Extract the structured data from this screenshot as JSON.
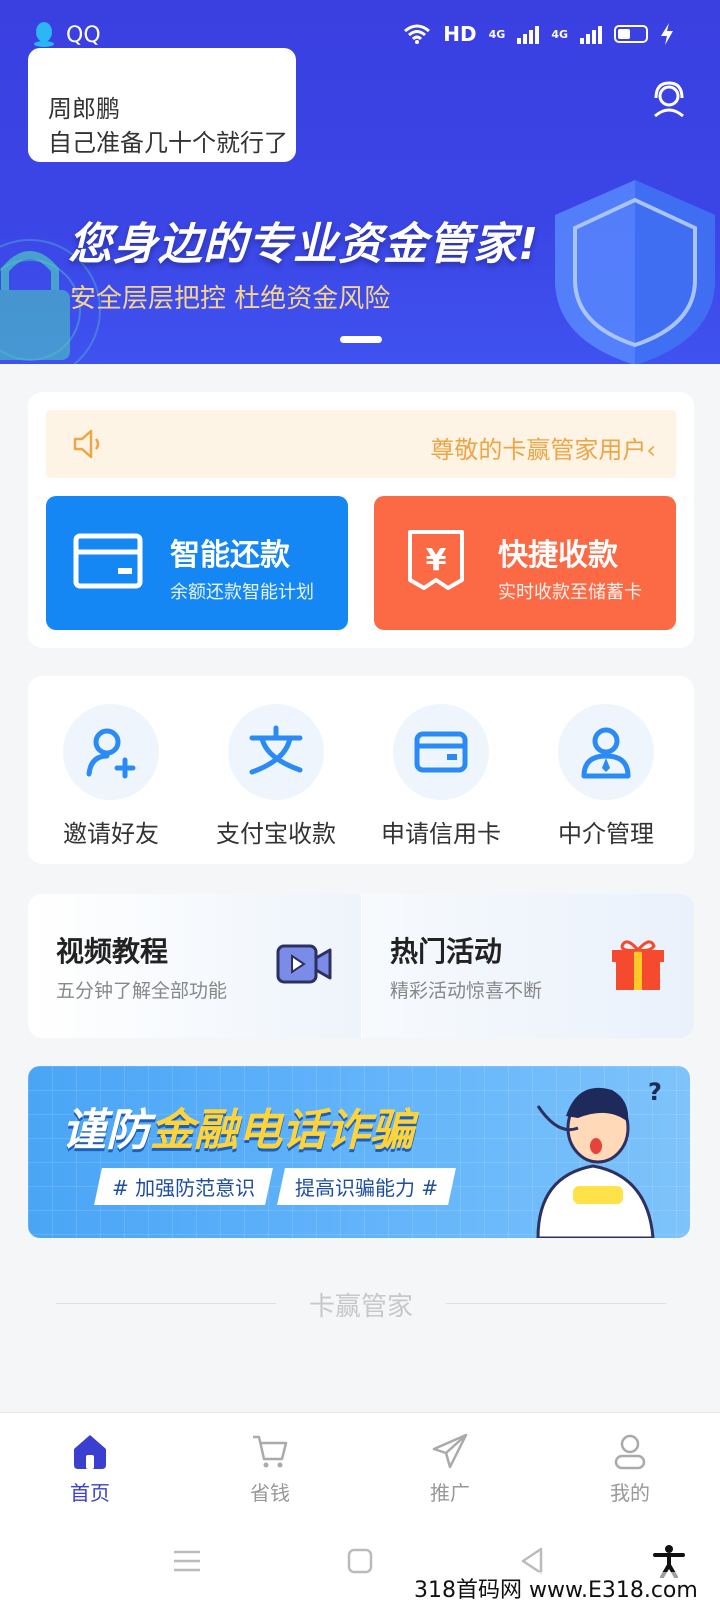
{
  "status_bar": {
    "app_name": "QQ",
    "network": "HD",
    "signal1": "4G",
    "signal2": "4G"
  },
  "notification": {
    "sender": "周郎鹏",
    "message": "自己准备几十个就行了"
  },
  "banner": {
    "title": "您身边的专业资金管家!",
    "subtitle": "安全层层把控 杜绝资金风险"
  },
  "notice": {
    "text": "尊敬的卡赢管家用户‹"
  },
  "actions": [
    {
      "title": "智能还款",
      "subtitle": "余额还款智能计划",
      "icon": "card-icon",
      "color": "#1487f5"
    },
    {
      "title": "快捷收款",
      "subtitle": "实时收款至储蓄卡",
      "icon": "yen-receipt-icon",
      "color": "#fb6a44"
    }
  ],
  "grid": [
    {
      "label": "邀请好友",
      "icon": "add-user-icon"
    },
    {
      "label": "支付宝收款",
      "icon": "alipay-icon"
    },
    {
      "label": "申请信用卡",
      "icon": "credit-card-icon"
    },
    {
      "label": "中介管理",
      "icon": "agent-icon"
    }
  ],
  "promos": [
    {
      "title": "视频教程",
      "subtitle": "五分钟了解全部功能",
      "icon": "video-icon"
    },
    {
      "title": "热门活动",
      "subtitle": "精彩活动惊喜不断",
      "icon": "gift-icon"
    }
  ],
  "fraud_banner": {
    "title_a": "谨防",
    "title_b": "金融电话诈骗",
    "tag1": "# 加强防范意识",
    "tag2": "提高识骗能力 #"
  },
  "footer": {
    "brand": "卡赢管家"
  },
  "tabs": [
    {
      "label": "首页",
      "icon": "home-icon",
      "active": true
    },
    {
      "label": "省钱",
      "icon": "cart-icon",
      "active": false
    },
    {
      "label": "推广",
      "icon": "send-icon",
      "active": false
    },
    {
      "label": "我的",
      "icon": "profile-icon",
      "active": false
    }
  ],
  "colors": {
    "header_blue": "#3a3fe0",
    "accent_blue": "#1487f5",
    "accent_orange": "#fb6a44",
    "notice_text": "#f0a545",
    "tab_active": "#3a3fd0"
  },
  "watermark": "318首码网 www.E318.com"
}
